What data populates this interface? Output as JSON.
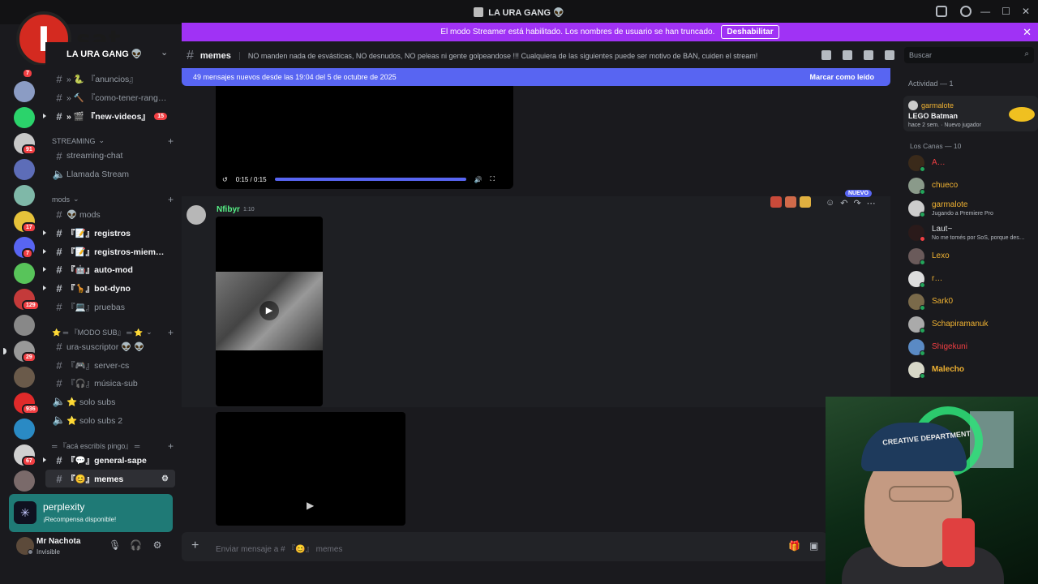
{
  "window": {
    "title": "LA URA GANG 👽"
  },
  "banner": {
    "text": "El modo Streamer está habilitado. Los nombres de usuario se han truncado.",
    "button": "Deshabilitar"
  },
  "logo": {
    "letter": "I",
    "text": "sat"
  },
  "guild": {
    "name": "LA URA GANG 👽"
  },
  "server_badges": [
    "7",
    "91",
    "17",
    "7",
    "129",
    "29",
    "936",
    "67"
  ],
  "channels": [
    {
      "label": "» 🐍 『anuncios』",
      "state": "normal"
    },
    {
      "label": "» 🔨 『como-tener-rang…",
      "state": "normal"
    },
    {
      "label": "» 🎬 『new-videos』",
      "state": "unread",
      "badge": "15"
    },
    {
      "label": "STREAMING",
      "type": "category"
    },
    {
      "label": "streaming-chat",
      "state": "normal"
    },
    {
      "label": "Llamada Stream",
      "state": "voice"
    },
    {
      "label": "mods",
      "type": "category"
    },
    {
      "label": "👽 mods",
      "state": "normal"
    },
    {
      "label": "『📝』registros",
      "state": "unread"
    },
    {
      "label": "『📝』registros-miem…",
      "state": "unread"
    },
    {
      "label": "『🤖』auto-mod",
      "state": "unread"
    },
    {
      "label": "『🦒』bot-dyno",
      "state": "unread"
    },
    {
      "label": "『💻』pruebas",
      "state": "normal"
    },
    {
      "label": "⭐ ═ 『MODO SUB』 ═ ⭐",
      "type": "category"
    },
    {
      "label": "ura-suscriptor 👽 👽",
      "state": "normal"
    },
    {
      "label": "『🎮』server-cs",
      "state": "normal"
    },
    {
      "label": "『🎧』música-sub",
      "state": "normal"
    },
    {
      "label": "⭐ solo subs",
      "state": "voice"
    },
    {
      "label": "⭐ solo subs 2",
      "state": "voice"
    },
    {
      "label": "═ 『acá escribís pingo』 ═",
      "type": "category"
    },
    {
      "label": "『💬』general-sape",
      "state": "unread"
    },
    {
      "label": "『😊』memes",
      "state": "active"
    }
  ],
  "perplexity": {
    "title": "perplexity",
    "subtitle": "¡Recompensa disponible!"
  },
  "user": {
    "name": "Mr Nachota",
    "status": "Invisible"
  },
  "chat": {
    "channel_name": "memes",
    "topic": "NO manden nada de esvásticas, NO desnudos, NO peleas ni gente golpeandose !!! Cualquiera de las siguientes puede ser motivo de BAN, cuiden el stream!",
    "search_placeholder": "Buscar",
    "new_messages": "49 mensajes nuevos desde las 19:04 del 5 de octubre de 2025",
    "mark_read": "Marcar como leído",
    "video_time": "0:15 / 0:15",
    "message_author": "Nfibyr",
    "message_time": "1:10",
    "nuevo_label": "NUEVO",
    "composer_placeholder": "Enviar mensaje a # 『😊』 memes"
  },
  "members": {
    "activity_title": "Actividad — 1",
    "activity": {
      "name": "garmalote",
      "game": "LEGO Batman",
      "time": "hace 2 sem.",
      "tag": "Nuevo jugador"
    },
    "role_title": "Los Canas — 10",
    "list": [
      {
        "name": "A…",
        "color": "#f23f43",
        "status": "online"
      },
      {
        "name": "chueco",
        "color": "#f0b232",
        "status": "online"
      },
      {
        "name": "garmalote",
        "color": "#f0b232",
        "status": "online",
        "sub": "Jugando a Premiere Pro"
      },
      {
        "name": "Laut~",
        "color": "#dbdee1",
        "status": "dnd",
        "sub": "No me tomés por SoS, porque des…"
      },
      {
        "name": "Lexo",
        "color": "#f0b232",
        "status": "online"
      },
      {
        "name": "r…",
        "color": "#f0b232",
        "status": "online"
      },
      {
        "name": "Sark0",
        "color": "#f0b232",
        "status": "online"
      },
      {
        "name": "Schapiramanuk",
        "color": "#f0b232",
        "status": "online"
      },
      {
        "name": "Shigekuni",
        "color": "#f23f43",
        "status": "online"
      },
      {
        "name": "Malecho",
        "color": "#f0b232",
        "status": "online"
      }
    ]
  },
  "webcam": {
    "cap_text": "CREATIVE DEPARTMENT"
  }
}
